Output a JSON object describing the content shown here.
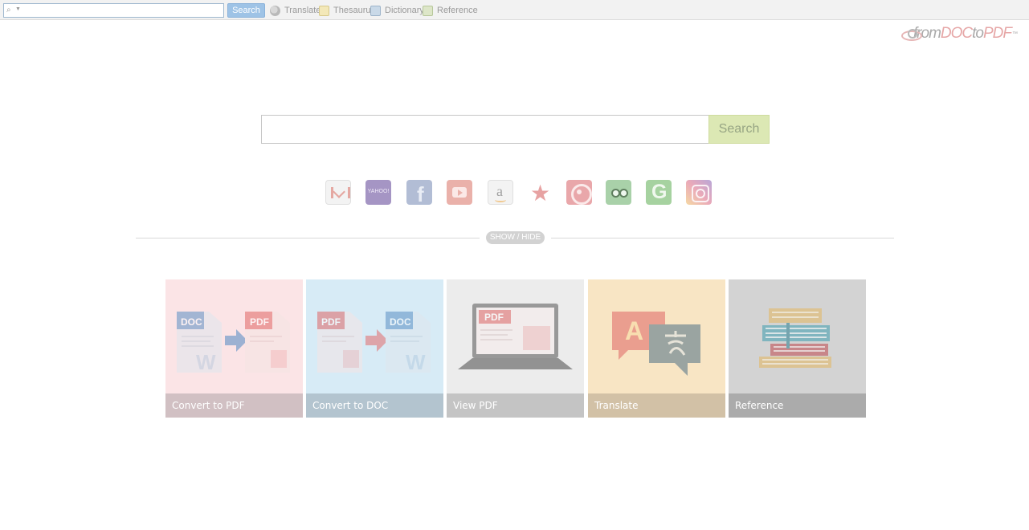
{
  "toolbar": {
    "search_value": "",
    "search_button": "Search",
    "links": [
      {
        "label": "Translate",
        "icon": "translate-icon"
      },
      {
        "label": "Thesaurus",
        "icon": "thesaurus-icon"
      },
      {
        "label": "Dictionary",
        "icon": "dictionary-icon"
      },
      {
        "label": "Reference",
        "icon": "reference-icon"
      }
    ]
  },
  "logo": {
    "prefix": "from",
    "highlight1": "DOC",
    "middle": "to",
    "highlight2": "PDF",
    "tm": "™"
  },
  "main_search": {
    "value": "",
    "button": "Search"
  },
  "quick_links": [
    {
      "name": "gmail",
      "icon": "gmail-icon"
    },
    {
      "name": "yahoo",
      "icon": "yahoo-icon",
      "text": "YAHOO!"
    },
    {
      "name": "facebook",
      "icon": "facebook-icon",
      "text": "f"
    },
    {
      "name": "youtube",
      "icon": "youtube-icon"
    },
    {
      "name": "amazon",
      "icon": "amazon-icon",
      "text": "a"
    },
    {
      "name": "macys",
      "icon": "star-icon",
      "text": "★"
    },
    {
      "name": "target",
      "icon": "target-icon"
    },
    {
      "name": "tripadvisor",
      "icon": "tripadvisor-icon"
    },
    {
      "name": "grammarly",
      "icon": "grammarly-icon",
      "text": "G"
    },
    {
      "name": "instagram",
      "icon": "instagram-icon"
    }
  ],
  "show_hide": "SHOW / HIDE",
  "tiles": [
    {
      "label": "Convert to PDF",
      "left_badge": "DOC",
      "right_badge": "PDF"
    },
    {
      "label": "Convert to DOC",
      "left_badge": "PDF",
      "right_badge": "DOC"
    },
    {
      "label": "View PDF",
      "badge": "PDF"
    },
    {
      "label": "Translate",
      "badge": "A"
    },
    {
      "label": "Reference"
    }
  ],
  "colors": {
    "toolbar_bg": "#f2f2f2",
    "search_button_bg": "#9ec3e6",
    "main_search_button_bg": "#dce8b4",
    "tile_pdf_bg": "#fbe4e6",
    "tile_doc_bg": "#d7ebf6",
    "tile_view_bg": "#ececec",
    "tile_translate_bg": "#f8e5c4",
    "tile_reference_bg": "#d3d3d3"
  }
}
